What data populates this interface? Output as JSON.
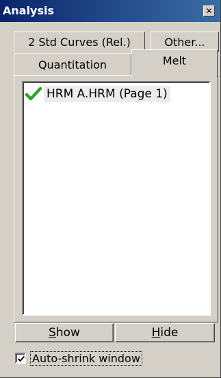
{
  "window": {
    "title": "Analysis",
    "close_glyph": "✕"
  },
  "tabs": [
    {
      "label": "2 Std Curves (Rel.)",
      "selected": false
    },
    {
      "label": "Other...",
      "selected": false
    },
    {
      "label": "Quantitation",
      "selected": false
    },
    {
      "label": "Melt",
      "selected": true
    }
  ],
  "list": {
    "items": [
      {
        "label": "HRM A.HRM (Page 1)",
        "icon": "checkmark-icon",
        "status_color": "#2fa12f",
        "selected": true
      }
    ]
  },
  "buttons": {
    "show": {
      "underlined_letter": "S",
      "rest": "how"
    },
    "hide": {
      "underlined_letter": "H",
      "rest": "ide"
    }
  },
  "auto_shrink": {
    "label": "Auto-shrink window",
    "checked": true
  }
}
